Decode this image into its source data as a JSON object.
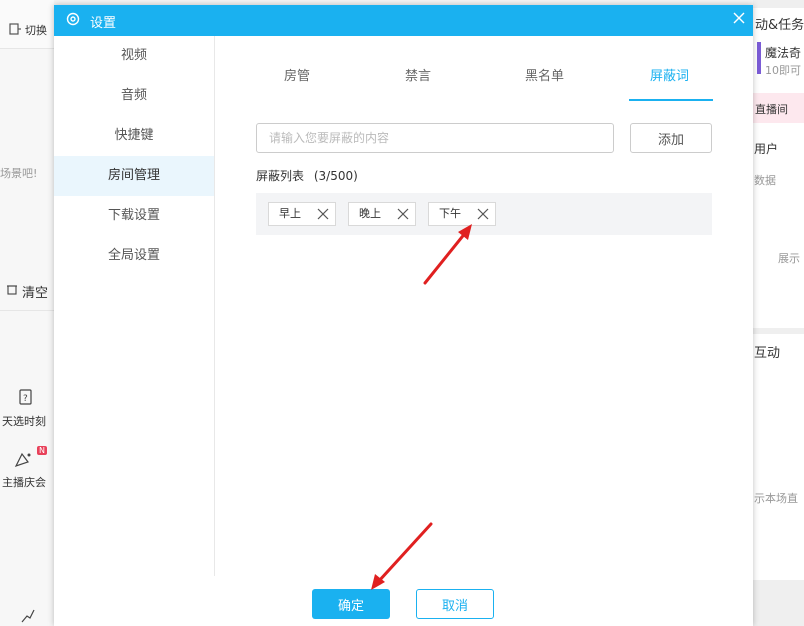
{
  "background_app": {
    "switch_label": "切换",
    "left_hint": "场景吧!",
    "clear_label": "清空",
    "tianxuan_label": "天选时刻",
    "party_label": "主播庆会",
    "new_badge": "N",
    "right_header": "动&任务",
    "magic_title": "魔法奇",
    "magic_sub": "10即可",
    "live_label": "直播间",
    "users_label": "用户",
    "data_label": "数据",
    "show_label": "展示",
    "interact_label": "互动",
    "room_live_label": "示本场直"
  },
  "dialog": {
    "title": "设置",
    "close_icon": "close-icon",
    "sidebar": [
      {
        "label": "视频",
        "active": false
      },
      {
        "label": "音频",
        "active": false
      },
      {
        "label": "快捷键",
        "active": false
      },
      {
        "label": "房间管理",
        "active": true
      },
      {
        "label": "下载设置",
        "active": false
      },
      {
        "label": "全局设置",
        "active": false
      }
    ],
    "tabs": [
      {
        "label": "房管",
        "active": false
      },
      {
        "label": "禁言",
        "active": false
      },
      {
        "label": "黑名单",
        "active": false
      },
      {
        "label": "屏蔽词",
        "active": true
      }
    ],
    "input_placeholder": "请输入您要屏蔽的内容",
    "input_value": "",
    "add_label": "添加",
    "list_title": "屏蔽列表",
    "list_count": "(3/500)",
    "words": [
      "早上",
      "晚上",
      "下午"
    ],
    "confirm_label": "确定",
    "cancel_label": "取消"
  },
  "colors": {
    "accent": "#1ab1f0",
    "annotation_arrow": "#e02020"
  }
}
